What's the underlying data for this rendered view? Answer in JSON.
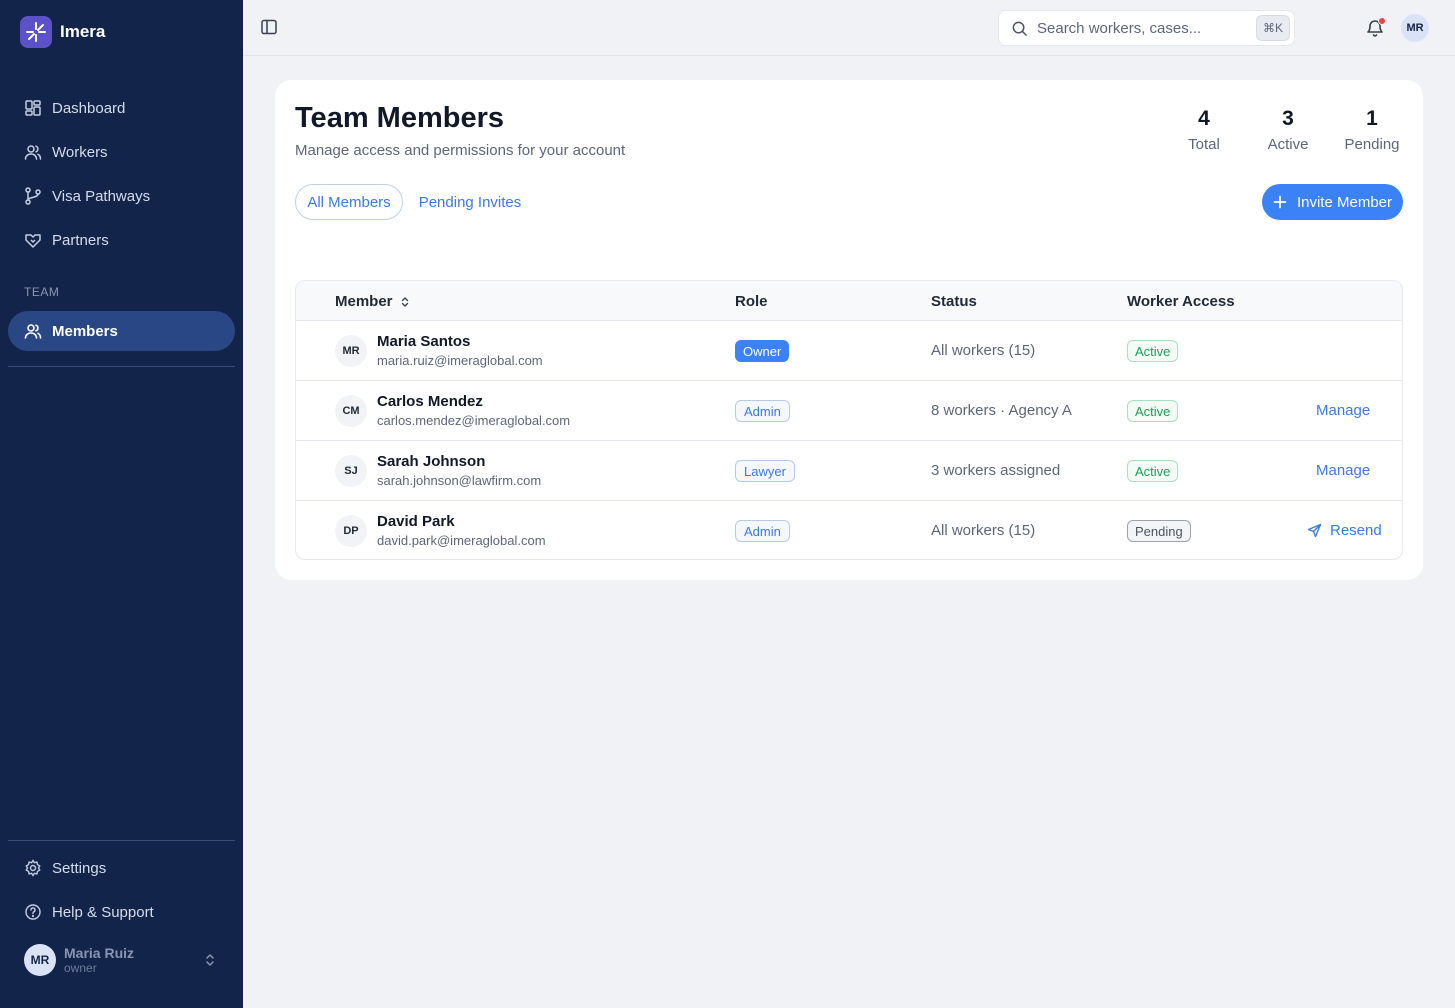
{
  "brand": {
    "name": "Imera"
  },
  "sidebar": {
    "items": [
      {
        "label": "Dashboard",
        "icon": "dashboard-icon"
      },
      {
        "label": "Workers",
        "icon": "users-icon"
      },
      {
        "label": "Visa Pathways",
        "icon": "git-branch-icon"
      },
      {
        "label": "Partners",
        "icon": "handshake-icon"
      }
    ],
    "section_label": "TEAM",
    "team_item": {
      "label": "Members",
      "icon": "users-icon",
      "active": true
    },
    "bottom_items": [
      {
        "label": "Settings",
        "icon": "gear-icon"
      },
      {
        "label": "Help & Support",
        "icon": "help-circle-icon"
      }
    ],
    "user": {
      "initials": "MR",
      "name": "Maria Ruiz",
      "role": "owner"
    }
  },
  "topbar": {
    "search_placeholder": "Search workers, cases...",
    "shortcut": "⌘K",
    "avatar_initials": "MR"
  },
  "page": {
    "title": "Team Members",
    "subtitle": "Manage access and permissions for your account",
    "stats": [
      {
        "value": "4",
        "label": "Total"
      },
      {
        "value": "3",
        "label": "Active"
      },
      {
        "value": "1",
        "label": "Pending"
      }
    ],
    "tabs": [
      {
        "label": "All Members",
        "active": true
      },
      {
        "label": "Pending Invites",
        "active": false
      }
    ],
    "invite_label": "Invite Member"
  },
  "table": {
    "headers": {
      "member": "Member",
      "role": "Role",
      "status": "Status",
      "access": "Worker Access"
    },
    "rows": [
      {
        "initials": "MR",
        "name": "Maria Santos",
        "email": "maria.ruiz@imeraglobal.com",
        "role": "Owner",
        "status": "All workers (15)",
        "access": "Active",
        "action": ""
      },
      {
        "initials": "CM",
        "name": "Carlos Mendez",
        "email": "carlos.mendez@imeraglobal.com",
        "role": "Admin",
        "status": "8 workers · Agency A",
        "access": "Active",
        "action": "Manage"
      },
      {
        "initials": "SJ",
        "name": "Sarah Johnson",
        "email": "sarah.johnson@lawfirm.com",
        "role": "Lawyer",
        "status": "3 workers assigned",
        "access": "Active",
        "action": "Manage"
      },
      {
        "initials": "DP",
        "name": "David Park",
        "email": "david.park@imeraglobal.com",
        "role": "Admin",
        "status": "All workers (15)",
        "access": "Pending",
        "action": "Resend"
      }
    ]
  },
  "colors": {
    "sidebar_bg": "#13244a",
    "sidebar_active": "#2a4785",
    "accent": "#3b82f6",
    "success": "#1f9d55",
    "notification": "#ef4444"
  }
}
